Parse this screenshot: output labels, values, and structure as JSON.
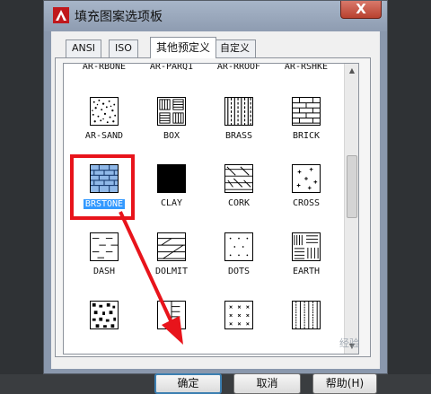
{
  "window": {
    "title": "填充图案选项板",
    "close_label": "X"
  },
  "tabs": [
    {
      "label": "ANSI"
    },
    {
      "label": "ISO"
    },
    {
      "label": "其他预定义"
    },
    {
      "label": "自定义"
    }
  ],
  "patterns": {
    "row0": [
      "AR-RBONE",
      "AR-PARQ1",
      "AR-RROOF",
      "AR-RSHKE"
    ],
    "row1": [
      "AR-SAND",
      "BOX",
      "BRASS",
      "BRICK"
    ],
    "row2": [
      "BRSTONE",
      "CLAY",
      "CORK",
      "CROSS"
    ],
    "row3": [
      "DASH",
      "DOLMIT",
      "DOTS",
      "EARTH"
    ]
  },
  "selected_pattern": "BRSTONE",
  "buttons": {
    "ok": "确定",
    "cancel": "取消",
    "help": "帮助(H)"
  },
  "colors": {
    "highlight": "#e8141b",
    "selection": "#3399ff",
    "brstone_fill": "#8fb8e8"
  },
  "watermark": "经验"
}
